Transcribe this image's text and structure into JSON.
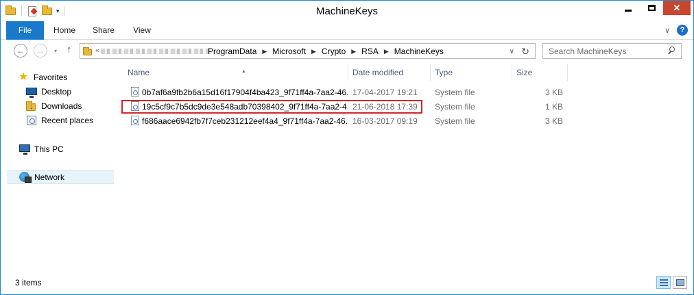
{
  "window": {
    "title": "MachineKeys"
  },
  "ribbon": {
    "tabs": [
      "File",
      "Home",
      "Share",
      "View"
    ]
  },
  "address": {
    "crumbs": [
      "ProgramData",
      "Microsoft",
      "Crypto",
      "RSA",
      "MachineKeys"
    ],
    "overflow_marker": "«"
  },
  "search": {
    "placeholder": "Search MachineKeys"
  },
  "nav": {
    "favorites": "Favorites",
    "desktop": "Desktop",
    "downloads": "Downloads",
    "recent": "Recent places",
    "this_pc": "This PC",
    "network": "Network"
  },
  "columns": {
    "name": "Name",
    "date": "Date modified",
    "type": "Type",
    "size": "Size"
  },
  "files": [
    {
      "name": "0b7af6a9fb2b6a15d16f17904f4ba423_9f71ff4a-7aa2-46...",
      "date": "17-04-2017 19:21",
      "type": "System file",
      "size": "3 KB"
    },
    {
      "name": "19c5cf9c7b5dc9de3e548adb70398402_9f71ff4a-7aa2-4...",
      "date": "21-06-2018 17:39",
      "type": "System file",
      "size": "1 KB"
    },
    {
      "name": "f686aace6942fb7f7ceb231212eef4a4_9f71ff4a-7aa2-46...",
      "date": "16-03-2017 09:19",
      "type": "System file",
      "size": "3 KB"
    }
  ],
  "status": {
    "count": "3 items"
  },
  "colors": {
    "accent": "#1979ca",
    "highlight": "#d0262a",
    "selection": "#e5f3fb"
  }
}
